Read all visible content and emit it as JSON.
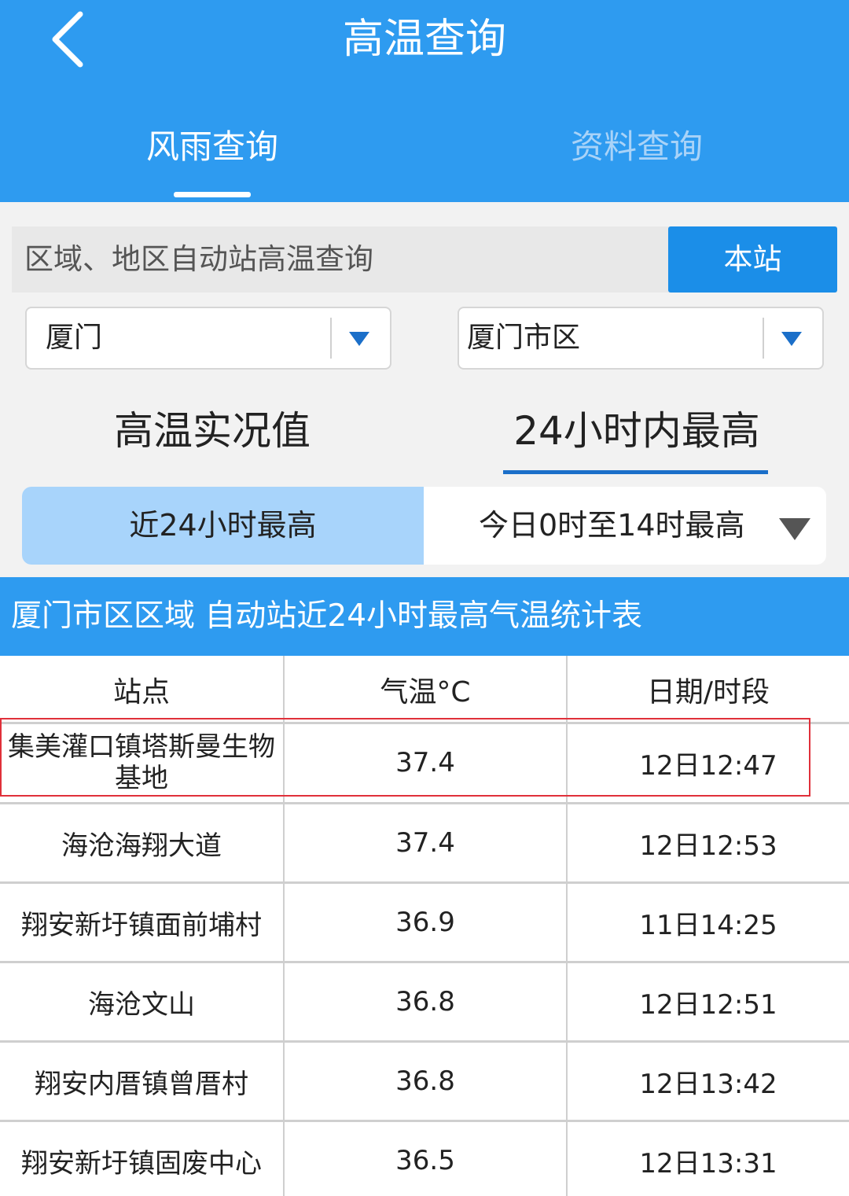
{
  "header": {
    "title": "高温查询"
  },
  "tabs": [
    {
      "label": "风雨查询"
    },
    {
      "label": "资料查询"
    }
  ],
  "query": {
    "label": "区域、地区自动站高温查询",
    "station_button": "本站"
  },
  "selects": {
    "city": "厦门",
    "district": "厦门市区"
  },
  "mode_tabs": [
    {
      "label": "高温实况值"
    },
    {
      "label": "24小时内最高"
    }
  ],
  "range": {
    "left": "近24小时最高",
    "right": "今日0时至14时最高"
  },
  "table": {
    "title": "厦门市区区域 自动站近24小时最高气温统计表",
    "headers": [
      "站点",
      "气温°C",
      "日期/时段"
    ],
    "rows": [
      {
        "station": "集美灌口镇塔斯曼生物基地",
        "temp": "37.4",
        "time": "12日12:47"
      },
      {
        "station": "海沧海翔大道",
        "temp": "37.4",
        "time": "12日12:53"
      },
      {
        "station": "翔安新圩镇面前埔村",
        "temp": "36.9",
        "time": "11日14:25"
      },
      {
        "station": "海沧文山",
        "temp": "36.8",
        "time": "12日12:51"
      },
      {
        "station": "翔安内厝镇曾厝村",
        "temp": "36.8",
        "time": "12日13:42"
      },
      {
        "station": "翔安新圩镇固废中心",
        "temp": "36.5",
        "time": "12日13:31"
      }
    ]
  },
  "colors": {
    "header": "#2e9bf0",
    "accent": "#1b8ee8",
    "highlight": "#e0303a"
  }
}
